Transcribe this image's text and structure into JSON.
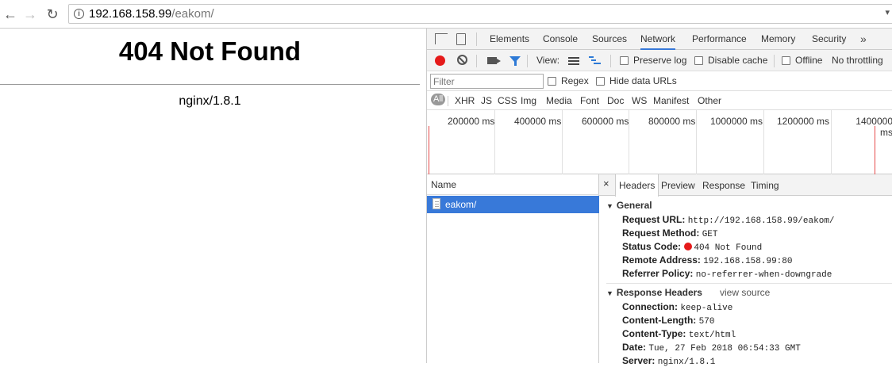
{
  "browser": {
    "url_host": "192.168.158.99",
    "url_path": "/eakom/"
  },
  "page": {
    "title": "404 Not Found",
    "server": "nginx/1.8.1"
  },
  "devtools": {
    "tabs": [
      "Elements",
      "Console",
      "Sources",
      "Network",
      "Performance",
      "Memory",
      "Security"
    ],
    "active_tab": "Network",
    "more": "»",
    "toolbar": {
      "view_label": "View:",
      "preserve_log": "Preserve log",
      "disable_cache": "Disable cache",
      "offline": "Offline",
      "throttling": "No throttling"
    },
    "filter": {
      "placeholder": "Filter",
      "regex": "Regex",
      "hide_data_urls": "Hide data URLs"
    },
    "types": [
      "All",
      "XHR",
      "JS",
      "CSS",
      "Img",
      "Media",
      "Font",
      "Doc",
      "WS",
      "Manifest",
      "Other"
    ],
    "timeline_ticks": [
      "200000 ms",
      "400000 ms",
      "600000 ms",
      "800000 ms",
      "1000000 ms",
      "1200000 ms",
      "1400000 ms"
    ],
    "list": {
      "header": "Name",
      "rows": [
        "eakom/"
      ]
    },
    "detail": {
      "close": "×",
      "tabs": [
        "Headers",
        "Preview",
        "Response",
        "Timing"
      ],
      "active_tab": "Headers",
      "general": {
        "title": "General",
        "request_url_k": "Request URL:",
        "request_url_v": "http://192.168.158.99/eakom/",
        "request_method_k": "Request Method:",
        "request_method_v": "GET",
        "status_code_k": "Status Code:",
        "status_code_v": "404 Not Found",
        "remote_address_k": "Remote Address:",
        "remote_address_v": "192.168.158.99:80",
        "referrer_policy_k": "Referrer Policy:",
        "referrer_policy_v": "no-referrer-when-downgrade"
      },
      "response_headers": {
        "title": "Response Headers",
        "view_source": "view source",
        "connection_k": "Connection:",
        "connection_v": "keep-alive",
        "content_length_k": "Content-Length:",
        "content_length_v": "570",
        "content_type_k": "Content-Type:",
        "content_type_v": "text/html",
        "date_k": "Date:",
        "date_v": "Tue, 27 Feb 2018 06:54:33 GMT",
        "server_k": "Server:",
        "server_v": "nginx/1.8.1"
      }
    }
  },
  "colors": {
    "record": "#e51a1a",
    "selected_row": "#3879d9",
    "active_tab_underline": "#3879d9"
  }
}
